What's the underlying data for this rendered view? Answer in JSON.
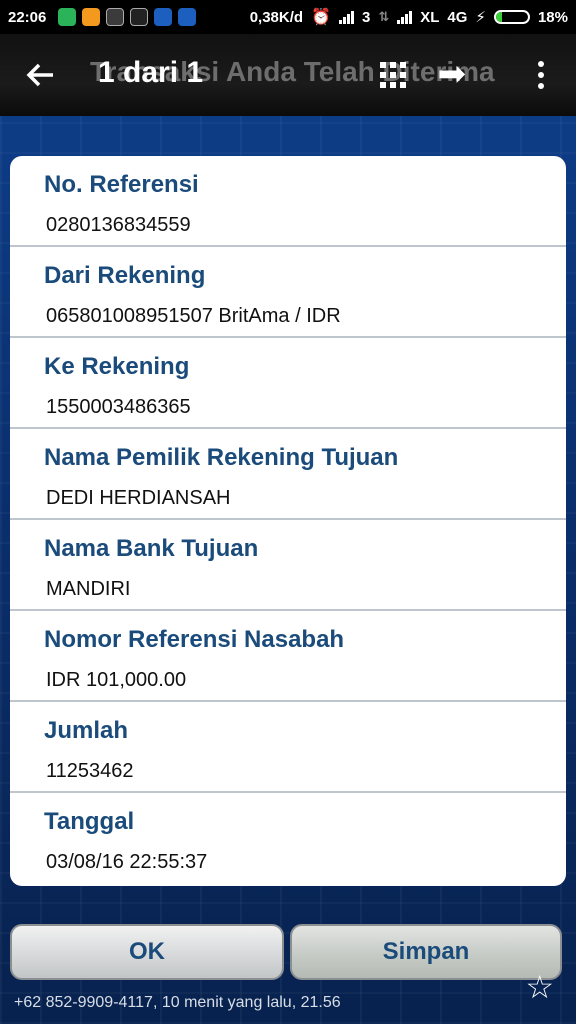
{
  "status_bar": {
    "time": "22:06",
    "net_speed": "0,38K/d",
    "sim1_label": "3",
    "carrier": "XL",
    "network": "4G",
    "battery": "18%",
    "battery_level": 0.18,
    "icons": [
      "shield-app-icon",
      "music-app-icon",
      "robot-app-icon",
      "bbm-app-icon",
      "c-app-icon",
      "c-app-icon",
      "alarm-icon",
      "signal-icon",
      "signal-icon",
      "charging-icon",
      "battery-icon"
    ]
  },
  "app_bar": {
    "title": "1 dari 1",
    "ghost_title": "Transaksi Anda Telah Diterima"
  },
  "details": [
    {
      "label": "No. Referensi",
      "value": "0280136834559"
    },
    {
      "label": "Dari Rekening",
      "value": "065801008951507 BritAma / IDR"
    },
    {
      "label": "Ke Rekening",
      "value": "1550003486365"
    },
    {
      "label": "Nama Pemilik Rekening Tujuan",
      "value": "DEDI HERDIANSAH"
    },
    {
      "label": "Nama Bank Tujuan",
      "value": "MANDIRI"
    },
    {
      "label": "Nomor Referensi Nasabah",
      "value": "IDR 101,000.00"
    },
    {
      "label": "Jumlah",
      "value": "11253462"
    },
    {
      "label": "Tanggal",
      "value": "03/08/16 22:55:37"
    }
  ],
  "buttons": {
    "ok": "OK",
    "save": "Simpan"
  },
  "footer": {
    "text": "+62 852-9909-4117, 10 menit yang lalu, 21.56"
  }
}
